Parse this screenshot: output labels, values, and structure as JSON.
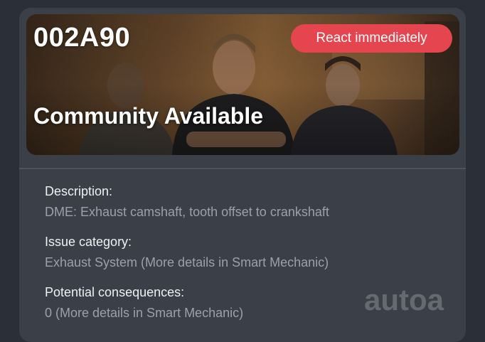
{
  "fault": {
    "code": "002A90",
    "headline": "Community Available",
    "badge": "React immediately"
  },
  "details": [
    {
      "label": "Description:",
      "value": "DME: Exhaust camshaft, tooth offset to crankshaft"
    },
    {
      "label": "Issue category:",
      "value": "Exhaust System (More details in Smart Mechanic)"
    },
    {
      "label": "Potential consequences:",
      "value": "0 (More details in Smart Mechanic)"
    }
  ],
  "watermark": "autoa",
  "colors": {
    "background": "#2b2f37",
    "card": "#3a3f48",
    "badge": "#e5454f",
    "label_text": "#eef0f3",
    "value_text": "#9ba1aa"
  }
}
